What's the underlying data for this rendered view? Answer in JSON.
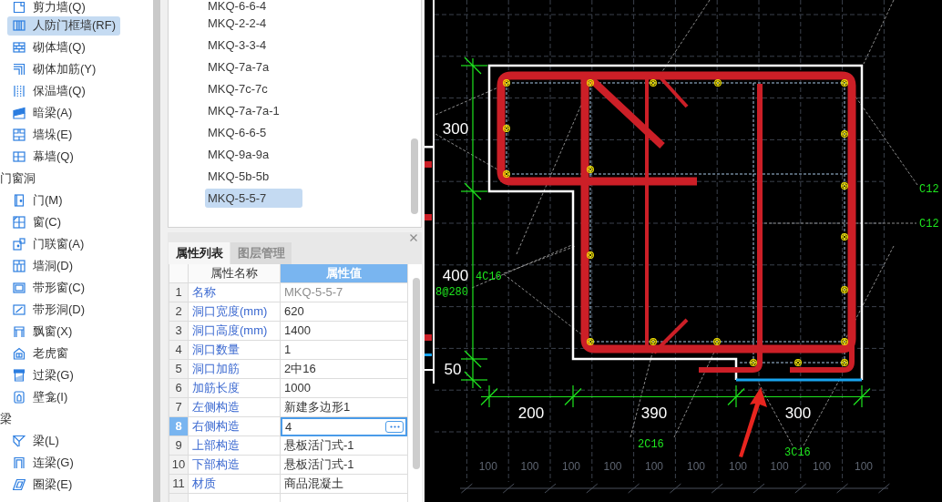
{
  "sidebar": {
    "sections": [
      {
        "items": [
          {
            "label": "剪力墙(Q)",
            "selected": false
          },
          {
            "label": "人防门框墙(RF)",
            "selected": true
          },
          {
            "label": "砌体墙(Q)",
            "selected": false
          },
          {
            "label": "砌体加筋(Y)",
            "selected": false
          },
          {
            "label": "保温墙(Q)",
            "selected": false
          },
          {
            "label": "暗梁(A)",
            "selected": false
          },
          {
            "label": "墙垛(E)",
            "selected": false
          },
          {
            "label": "幕墙(Q)",
            "selected": false
          }
        ]
      },
      {
        "title": "门窗洞",
        "items": [
          {
            "label": "门(M)",
            "selected": false
          },
          {
            "label": "窗(C)",
            "selected": false
          },
          {
            "label": "门联窗(A)",
            "selected": false
          },
          {
            "label": "墙洞(D)",
            "selected": false
          },
          {
            "label": "带形窗(C)",
            "selected": false
          },
          {
            "label": "带形洞(D)",
            "selected": false
          },
          {
            "label": "飘窗(X)",
            "selected": false
          },
          {
            "label": "老虎窗",
            "selected": false
          },
          {
            "label": "过梁(G)",
            "selected": false
          },
          {
            "label": "壁龛(I)",
            "selected": false
          }
        ]
      },
      {
        "title": "梁",
        "items": [
          {
            "label": "梁(L)",
            "selected": false
          },
          {
            "label": "连梁(G)",
            "selected": false
          },
          {
            "label": "圈梁(E)",
            "selected": false
          }
        ]
      }
    ]
  },
  "component_list": {
    "items": [
      {
        "label": "MKQ-6-6-4",
        "selected": false
      },
      {
        "label": "MKQ-2-2-4",
        "selected": false
      },
      {
        "label": "MKQ-3-3-4",
        "selected": false
      },
      {
        "label": "MKQ-7a-7a",
        "selected": false
      },
      {
        "label": "MKQ-7c-7c",
        "selected": false
      },
      {
        "label": "MKQ-7a-7a-1",
        "selected": false
      },
      {
        "label": "MKQ-6-6-5",
        "selected": false
      },
      {
        "label": "MKQ-9a-9a",
        "selected": false
      },
      {
        "label": "MKQ-5b-5b",
        "selected": false
      },
      {
        "label": "MKQ-5-5-7",
        "selected": true
      }
    ]
  },
  "property_panel": {
    "tabs": [
      {
        "label": "属性列表",
        "selected": true
      },
      {
        "label": "图层管理",
        "selected": false
      }
    ],
    "columns": [
      "属性名称",
      "属性值"
    ],
    "rows": [
      {
        "number": "1",
        "name": "名称",
        "value": "MKQ-5-5-7",
        "disabled": true,
        "selected": false
      },
      {
        "number": "2",
        "name": "洞口宽度(mm)",
        "value": "620",
        "disabled": false,
        "selected": false
      },
      {
        "number": "3",
        "name": "洞口高度(mm)",
        "value": "1400",
        "disabled": false,
        "selected": false
      },
      {
        "number": "4",
        "name": "洞口数量",
        "value": "1",
        "disabled": false,
        "selected": false
      },
      {
        "number": "5",
        "name": "洞口加筋",
        "value": "2中16",
        "disabled": false,
        "selected": false
      },
      {
        "number": "6",
        "name": "加筋长度",
        "value": "1000",
        "disabled": false,
        "selected": false
      },
      {
        "number": "7",
        "name": "左侧构造",
        "value": "新建多边形1",
        "disabled": false,
        "selected": false
      },
      {
        "number": "8",
        "name": "右侧构造",
        "value": "4",
        "disabled": false,
        "selected": true
      },
      {
        "number": "9",
        "name": "上部构造",
        "value": "悬板活门式-1",
        "disabled": false,
        "selected": false
      },
      {
        "number": "10",
        "name": "下部构造",
        "value": "悬板活门式-1",
        "disabled": false,
        "selected": false
      },
      {
        "number": "11",
        "name": "材质",
        "value": "商品混凝土",
        "disabled": false,
        "selected": false
      }
    ]
  },
  "canvas": {
    "dimension_labels": [
      "300",
      "400",
      "50",
      "200",
      "390",
      "300"
    ],
    "rebar_labels": [
      "4C16",
      "8@280",
      "2C16",
      "3C16",
      "C12",
      "C12"
    ],
    "scale_labels": [
      "100",
      "100",
      "100",
      "100",
      "100",
      "100",
      "100",
      "100",
      "100",
      "100"
    ]
  }
}
